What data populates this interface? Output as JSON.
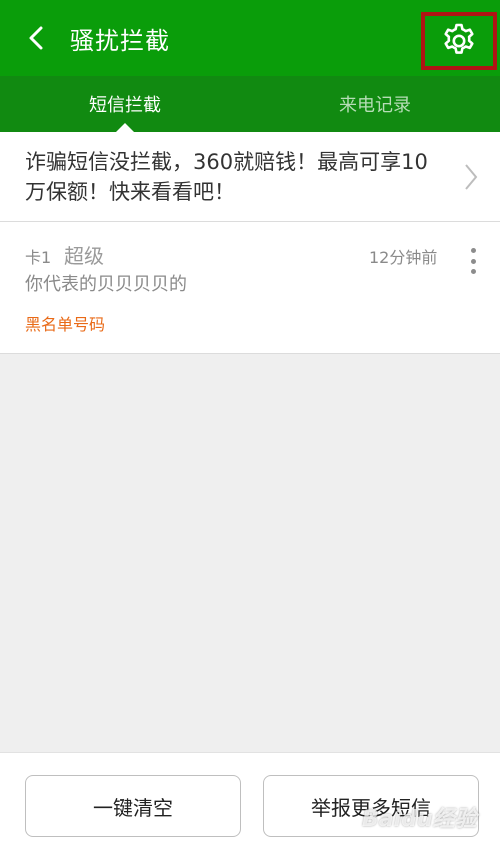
{
  "header": {
    "title": "骚扰拦截",
    "back_icon": "chevron-left-icon",
    "settings_icon": "gear-icon",
    "bg_color": "#0a9d0a"
  },
  "tabs": [
    {
      "label": "短信拦截",
      "active": true
    },
    {
      "label": "来电记录",
      "active": false
    }
  ],
  "promo": {
    "text": "诈骗短信没拦截，360就赔钱！最高可享10万保额！快来看看吧！"
  },
  "messages": [
    {
      "card": "卡1",
      "sender": "超级",
      "time": "12分钟前",
      "body": "你代表的贝贝贝贝的",
      "tag": "黑名单号码",
      "tag_color": "#e96a17"
    }
  ],
  "actions": {
    "clear_label": "一键清空",
    "report_label": "举报更多短信"
  },
  "watermark": "Baidu经验"
}
